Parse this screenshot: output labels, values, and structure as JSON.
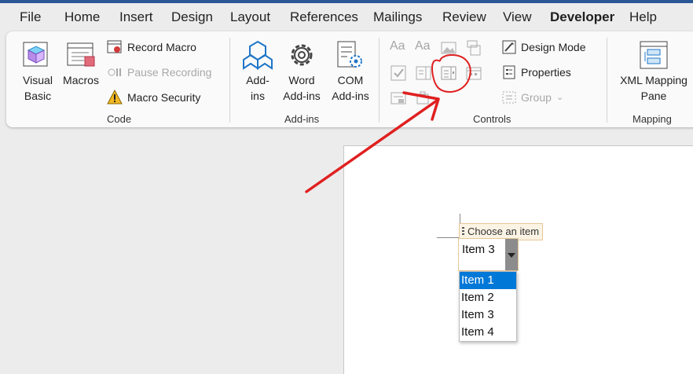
{
  "tabs": [
    "File",
    "Home",
    "Insert",
    "Design",
    "Layout",
    "References",
    "Mailings",
    "Review",
    "View",
    "Developer",
    "Help"
  ],
  "active_tab": "Developer",
  "code_group": {
    "visual_basic": [
      "Visual",
      "Basic"
    ],
    "macros": "Macros",
    "record_macro": "Record Macro",
    "pause_recording": "Pause Recording",
    "macro_security": "Macro Security",
    "label": "Code"
  },
  "addins_group": {
    "addins": [
      "Add-",
      "ins"
    ],
    "word_addins": [
      "Word",
      "Add-ins"
    ],
    "com_addins": [
      "COM",
      "Add-ins"
    ],
    "label": "Add-ins"
  },
  "controls_group": {
    "design_mode": "Design Mode",
    "properties": "Properties",
    "group": "Group",
    "label": "Controls"
  },
  "mapping_group": {
    "xml_mapping": [
      "XML Mapping",
      "Pane"
    ],
    "label": "Mapping"
  },
  "document": {
    "content_control_title": "Choose an item",
    "selected_value": "Item 3",
    "items": [
      "Item 1",
      "Item 2",
      "Item 3",
      "Item 4"
    ],
    "highlighted_item": "Item 1"
  },
  "colors": {
    "accent": "#2b5797",
    "selection": "#0078d7",
    "annotation": "#e02020"
  }
}
